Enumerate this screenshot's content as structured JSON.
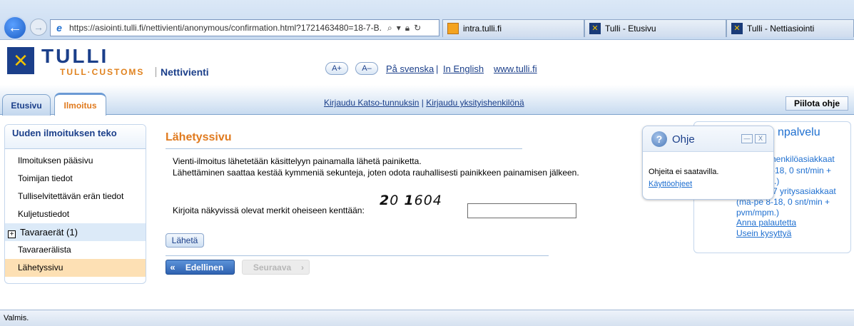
{
  "browser": {
    "url": "https://asiointi.tulli.fi/nettivienti/anonymous/confirmation.html?1721463480=18-7-B.",
    "tabs": [
      {
        "title": "intra.tulli.fi"
      },
      {
        "title": "Tulli - Etusivu"
      },
      {
        "title": "Tulli - Nettiasiointi"
      }
    ],
    "status": "Valmis."
  },
  "header": {
    "brand": "TULLI",
    "brand_sub": "TULL·CUSTOMS",
    "app_name": "Nettivienti",
    "font_increase": "A+",
    "font_decrease": "A–",
    "lang_swedish": "På svenska",
    "lang_english": "In English",
    "site_link": "www.tulli.fi",
    "tabs": [
      "Etusivu",
      "Ilmoitus"
    ],
    "login_katso": "Kirjaudu Katso-tunnuksin",
    "login_private": "Kirjaudu yksityishenkilönä",
    "hide_help": "Piilota ohje"
  },
  "sidebar": {
    "title": "Uuden ilmoituksen teko",
    "items": [
      {
        "label": "Ilmoituksen pääsivu"
      },
      {
        "label": "Toimijan tiedot"
      },
      {
        "label": "Tulliselvitettävän erän tiedot"
      },
      {
        "label": "Kuljetustiedot"
      },
      {
        "label": "Tavaraerät (1)"
      },
      {
        "label": "Tavaraerälista"
      },
      {
        "label": "Lähetyssivu"
      }
    ]
  },
  "main": {
    "title": "Lähetyssivu",
    "info_line1": "Vienti-ilmoitus lähetetään käsittelyyn painamalla lähetä painiketta.",
    "info_line2": "Lähettäminen saattaa kestää kymmeniä sekunteja, joten odota rauhallisesti painikkeen painamisen jälkeen.",
    "captcha_a": "2",
    "captcha_b": "0",
    "captcha_c": "1",
    "captcha_d": "604",
    "captcha_label": "Kirjoita näkyvissä olevat merkit oheiseen kenttään:",
    "captcha_value": "",
    "send_button": "Lähetä",
    "prev_button": "Edellinen",
    "next_button": "Seuraava"
  },
  "help": {
    "title": "Ohje",
    "body": "Ohjeita ei saatavilla.",
    "link": "Käyttöohjeet"
  },
  "customer_service": {
    "title": "npalvelu",
    "lines": [
      "6 henkilöasiakkaat",
      "-18, 0 snt/min +",
      ".)",
      "7 yritysasiakkaat",
      "(ma-pe 8-18, 0 snt/min +",
      "pvm/mpm.)"
    ],
    "feedback": "Anna palautetta",
    "faq": "Usein kysyttyä"
  }
}
